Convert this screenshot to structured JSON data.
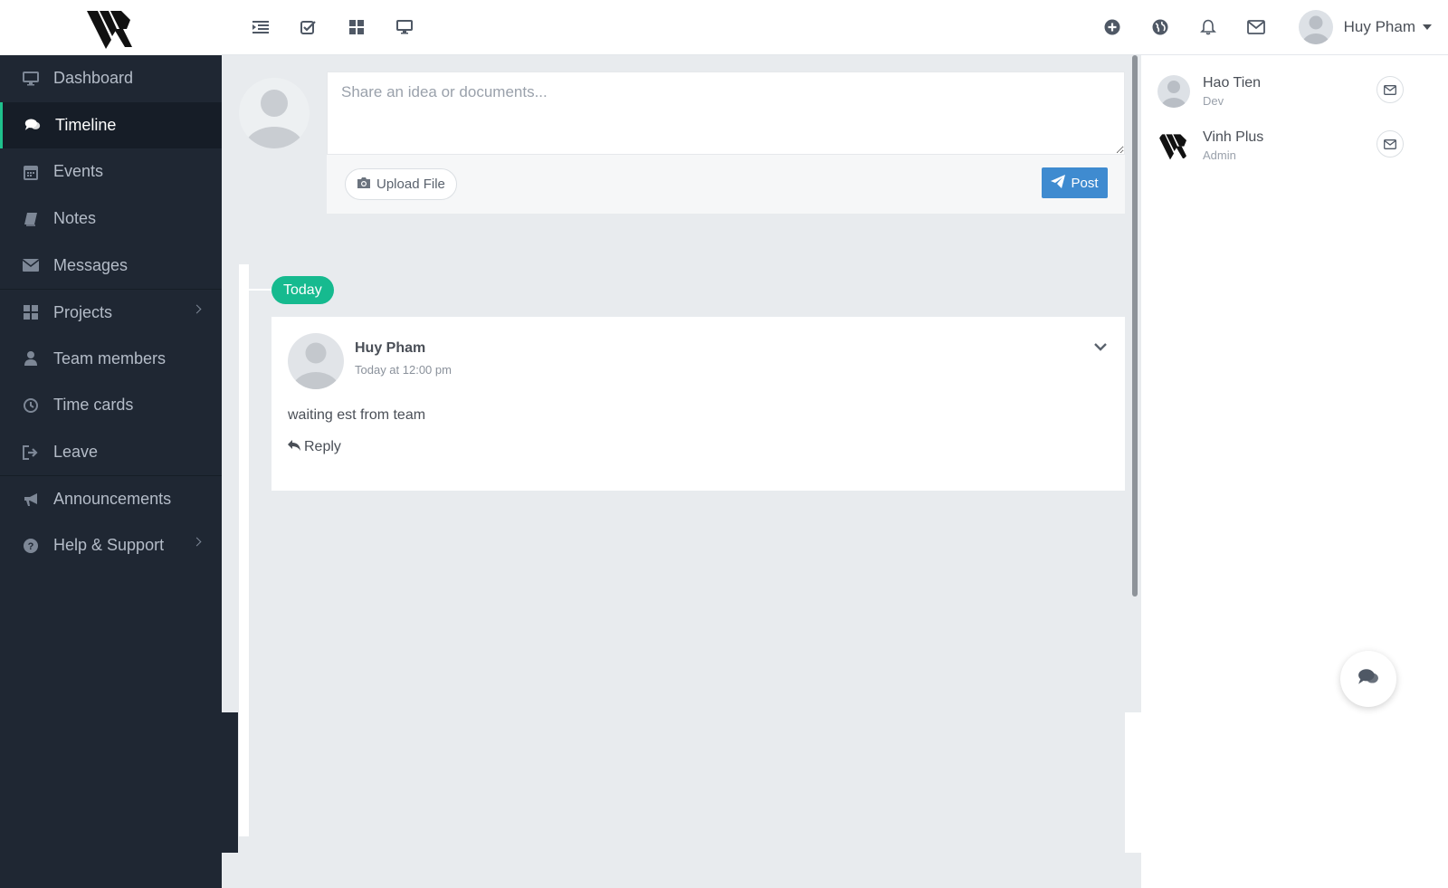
{
  "sidebar": {
    "items": [
      {
        "label": "Dashboard",
        "icon": "monitor-icon"
      },
      {
        "label": "Timeline",
        "icon": "comments-icon",
        "active": true
      },
      {
        "label": "Events",
        "icon": "calendar-icon"
      },
      {
        "label": "Notes",
        "icon": "book-icon"
      },
      {
        "label": "Messages",
        "icon": "envelope-icon"
      },
      {
        "label": "Projects",
        "icon": "grid-icon",
        "has_submenu": true
      },
      {
        "label": "Team members",
        "icon": "user-icon"
      },
      {
        "label": "Time cards",
        "icon": "clock-icon"
      },
      {
        "label": "Leave",
        "icon": "sign-out-icon"
      },
      {
        "label": "Announcements",
        "icon": "bullhorn-icon"
      },
      {
        "label": "Help & Support",
        "icon": "question-circle-icon",
        "has_submenu": true
      }
    ]
  },
  "topbar": {
    "user_name": "Huy Pham"
  },
  "composer": {
    "placeholder": "Share an idea or documents...",
    "upload_label": "Upload File",
    "post_label": "Post"
  },
  "timeline": {
    "date_badge": "Today",
    "post": {
      "author": "Huy Pham",
      "time": "Today at 12:00 pm",
      "text": "waiting est from team",
      "reply_label": "Reply"
    }
  },
  "members": [
    {
      "name": "Hao Tien",
      "role": "Dev"
    },
    {
      "name": "Vinh Plus",
      "role": "Admin"
    }
  ],
  "colors": {
    "sidebar_bg": "#1f2733",
    "accent_green": "#16ba8f",
    "post_button": "#3f8bd0",
    "main_bg": "#e8ebee"
  }
}
